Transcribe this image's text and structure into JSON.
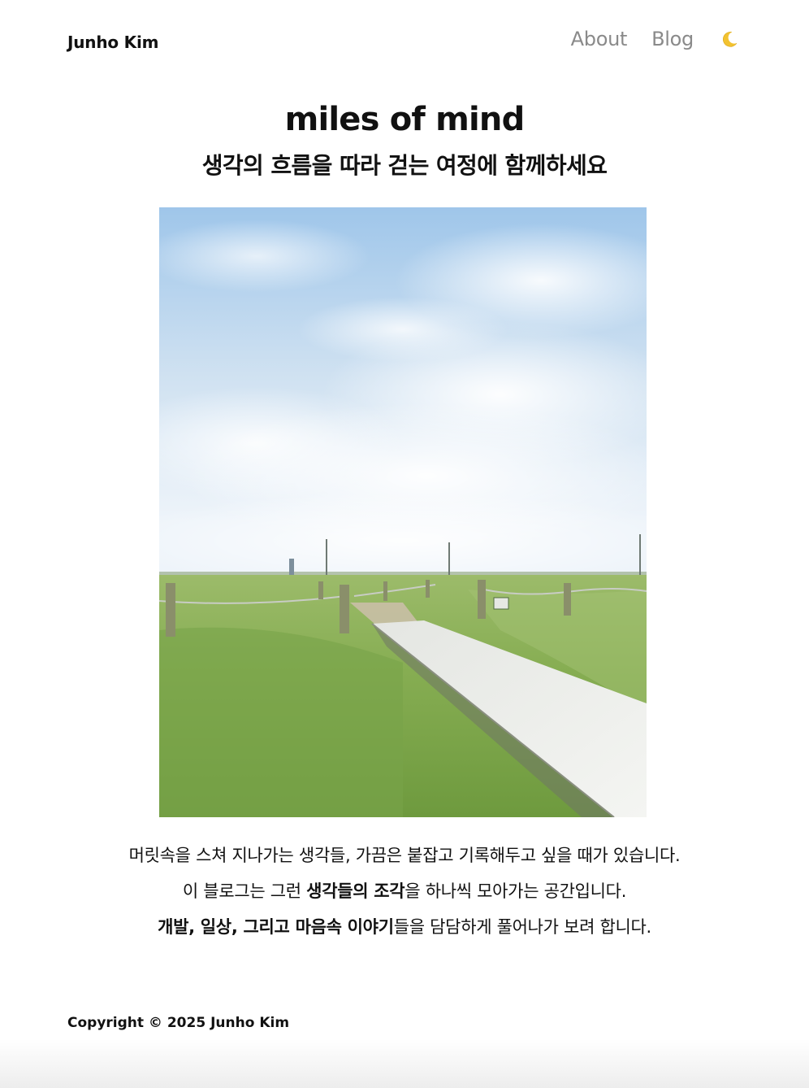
{
  "header": {
    "brand": "Junho Kim",
    "nav": [
      {
        "label": "About"
      },
      {
        "label": "Blog"
      }
    ],
    "theme_toggle_icon": "moon-icon"
  },
  "main": {
    "title": "miles of mind",
    "subtitle": "생각의 흐름을 따라 걷는 여정에 함께하세요",
    "hero_image": "photo-boardwalk-grass-field-sky",
    "intro": {
      "line1": "머릿속을 스쳐 지나가는 생각들, 가끔은 붙잡고 기록해두고 싶을 때가 있습니다.",
      "line2_before": "이 블로그는 그런 ",
      "line2_bold": "생각들의 조각",
      "line2_after": "을 하나씩 모아가는 공간입니다.",
      "line3_bold": "개발, 일상, 그리고 마음속 이야기",
      "line3_after": "들을 담담하게 풀어나가 보려 합니다."
    }
  },
  "footer": {
    "copyright": "Copyright © 2025 Junho Kim"
  },
  "colors": {
    "moon": "#f2c230",
    "nav_text": "#8a8a8a",
    "sky": "#a9cbe8",
    "grass": "#7aa34a"
  }
}
